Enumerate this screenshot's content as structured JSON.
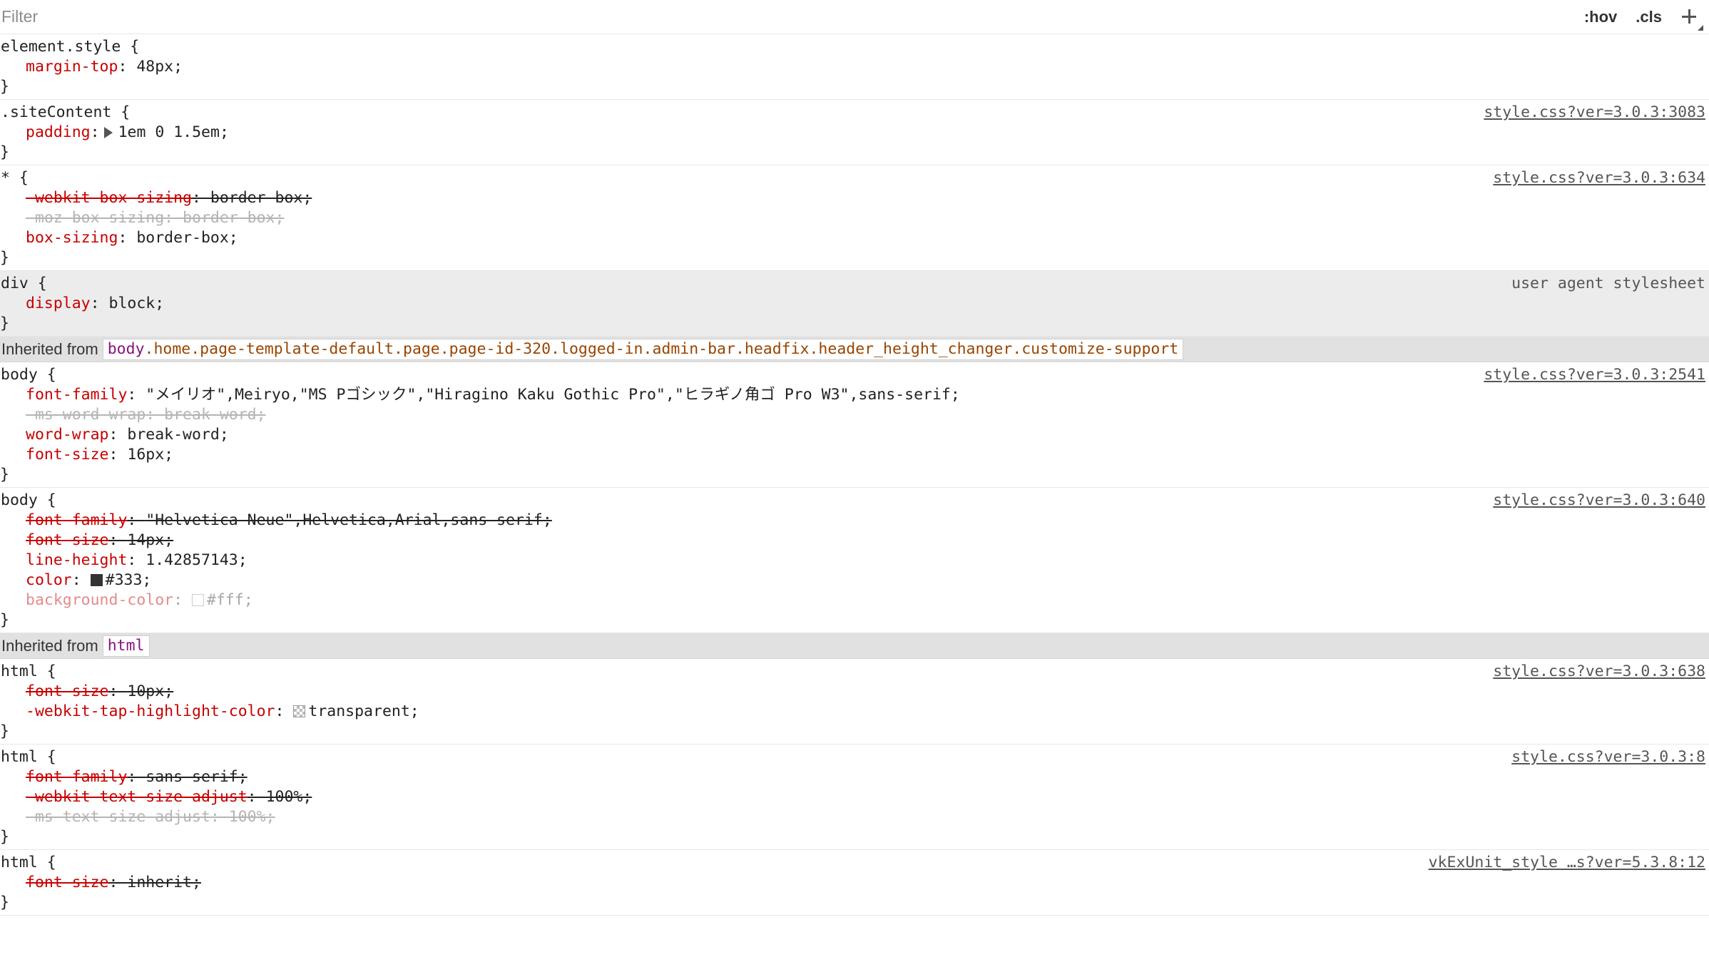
{
  "toolbar": {
    "filter_placeholder": "Filter",
    "hov_label": ":hov",
    "cls_label": ".cls",
    "add_rule_icon": "plus-icon"
  },
  "rules": {
    "element_style": {
      "selector": "element.style {",
      "close": "}",
      "decls": [
        {
          "name": "margin-top",
          "value": "48px;"
        }
      ]
    },
    "site_content": {
      "selector": ".siteContent {",
      "source": "style.css?ver=3.0.3:3083",
      "close": "}",
      "decls": [
        {
          "name": "padding",
          "value": "1em 0 1.5em;"
        }
      ]
    },
    "universal": {
      "selector": "* {",
      "source": "style.css?ver=3.0.3:634",
      "close": "}",
      "decls": [
        {
          "name": "-webkit-box-sizing",
          "value": "border-box;"
        },
        {
          "name": "-moz-box-sizing",
          "value": "border-box;"
        },
        {
          "name": "box-sizing",
          "value": "border-box;"
        }
      ]
    },
    "div_ua": {
      "selector": "div {",
      "source": "user agent stylesheet",
      "close": "}",
      "decls": [
        {
          "name": "display",
          "value": "block;"
        }
      ]
    },
    "body_1": {
      "selector": "body {",
      "source": "style.css?ver=3.0.3:2541",
      "close": "}",
      "decls": [
        {
          "name": "font-family",
          "value": "\"メイリオ\",Meiryo,\"MS Pゴシック\",\"Hiragino Kaku Gothic Pro\",\"ヒラギノ角ゴ Pro W3\",sans-serif;"
        },
        {
          "name": "-ms-word-wrap",
          "value": "break-word;"
        },
        {
          "name": "word-wrap",
          "value": "break-word;"
        },
        {
          "name": "font-size",
          "value": "16px;"
        }
      ]
    },
    "body_2": {
      "selector": "body {",
      "source": "style.css?ver=3.0.3:640",
      "close": "}",
      "decls": [
        {
          "name": "font-family",
          "value": "\"Helvetica Neue\",Helvetica,Arial,sans-serif;"
        },
        {
          "name": "font-size",
          "value": "14px;"
        },
        {
          "name": "line-height",
          "value": "1.42857143;"
        },
        {
          "name": "color",
          "value": "#333;"
        },
        {
          "name": "background-color",
          "value": "#fff;"
        }
      ]
    },
    "html_1": {
      "selector": "html {",
      "source": "style.css?ver=3.0.3:638",
      "close": "}",
      "decls": [
        {
          "name": "font-size",
          "value": "10px;"
        },
        {
          "name": "-webkit-tap-highlight-color",
          "value": "transparent;"
        }
      ]
    },
    "html_2": {
      "selector": "html {",
      "source": "style.css?ver=3.0.3:8",
      "close": "}",
      "decls": [
        {
          "name": "font-family",
          "value": "sans-serif;"
        },
        {
          "name": "-webkit-text-size-adjust",
          "value": "100%;"
        },
        {
          "name": "-ms-text-size-adjust",
          "value": "100%;"
        }
      ]
    },
    "html_3": {
      "selector": "html {",
      "source": "vkExUnit_style …s?ver=5.3.8:12",
      "close": "}",
      "decls": [
        {
          "name": "font-size",
          "value": "inherit;"
        }
      ]
    }
  },
  "inherited_body": {
    "label": "Inherited from",
    "tag": "body",
    "classes": ".home.page-template-default.page.page-id-320.logged-in.admin-bar.headfix.header_height_changer.customize-support"
  },
  "inherited_html": {
    "label": "Inherited from",
    "tag": "html"
  },
  "punct": {
    "colon": ": "
  },
  "colors": {
    "property_name": "#c80000",
    "tag": "#881280",
    "class": "#994500",
    "user_agent_bg": "#ececec",
    "inherited_bg": "#e1e1e1",
    "swatch_333": "#333333",
    "swatch_fff": "#ffffff"
  }
}
